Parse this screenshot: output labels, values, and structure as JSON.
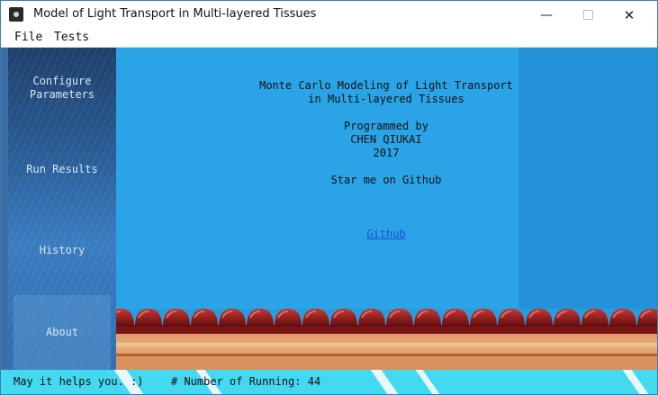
{
  "window": {
    "title": "Model of Light Transport in Multi-layered Tissues",
    "controls": {
      "minimize": "—",
      "close": "✕"
    }
  },
  "menu": [
    "File",
    "Tests"
  ],
  "sidebar": {
    "items": [
      {
        "label_line1": "Configure",
        "label_line2": "Parameters"
      },
      {
        "label": "Run Results"
      },
      {
        "label": "History"
      },
      {
        "label": "About",
        "selected": true
      }
    ]
  },
  "about": {
    "line1": "Monte Carlo Modeling of Light Transport",
    "line2": "in Multi-layered Tissues",
    "line3": "Programmed by",
    "line4": "CHEN QIUKAI",
    "line5": "2017",
    "line6": "Star me on Github",
    "link": "Github"
  },
  "status": {
    "message": "May it helps you. :)",
    "running": "# Number of Running: 44"
  },
  "colors": {
    "sidebar": "#2a5f98",
    "main_background": "#2aa4e6",
    "status_bar": "#43d9f0",
    "link": "#1a4fd6",
    "roof_tile": "#8c1c1c"
  }
}
